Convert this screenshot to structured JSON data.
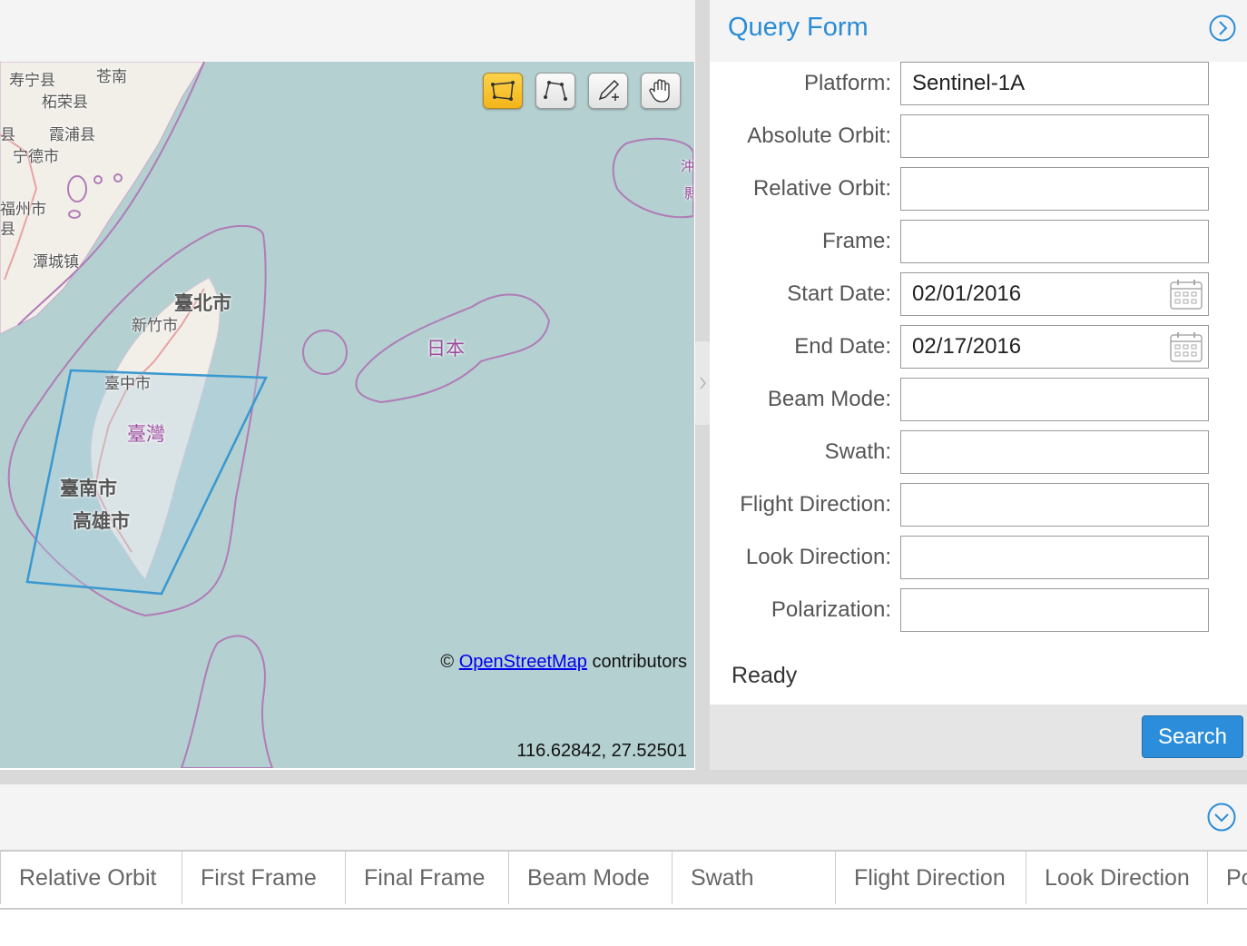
{
  "map": {
    "labels": {
      "shouning": "寿宁县",
      "cangnan": "苍南",
      "zherong": "柘荣县",
      "xiapu": "霞浦县",
      "county_left": "县",
      "ningde": "宁德市",
      "fuzhou": "福州市",
      "county_left2": "县",
      "tancheng": "潭城镇",
      "taipei": "臺北市",
      "hsinchu": "新竹市",
      "taichung": "臺中市",
      "taiwan": "臺灣",
      "tainan": "臺南市",
      "kaohsiung": "高雄市",
      "japan": "日本",
      "okinawa_partial": "沖",
      "okinawa_partial2": "縣"
    },
    "tools": [
      {
        "name": "box-draw",
        "active": true
      },
      {
        "name": "polygon-draw",
        "active": false
      },
      {
        "name": "point-edit",
        "active": false
      },
      {
        "name": "pan",
        "active": false
      }
    ],
    "attribution_prefix": "©",
    "attribution_link": "OpenStreetMap",
    "attribution_suffix": "contributors",
    "coordinates": "116.62842, 27.52501"
  },
  "form": {
    "title": "Query Form",
    "fields": [
      {
        "label": "Platform:",
        "value": "Sentinel-1A"
      },
      {
        "label": "Absolute Orbit:",
        "value": ""
      },
      {
        "label": "Relative Orbit:",
        "value": ""
      },
      {
        "label": "Frame:",
        "value": ""
      },
      {
        "label": "Start Date:",
        "value": "02/01/2016"
      },
      {
        "label": "End Date:",
        "value": "02/17/2016"
      },
      {
        "label": "Beam Mode:",
        "value": ""
      },
      {
        "label": "Swath:",
        "value": ""
      },
      {
        "label": "Flight Direction:",
        "value": ""
      },
      {
        "label": "Look Direction:",
        "value": ""
      },
      {
        "label": "Polarization:",
        "value": ""
      }
    ],
    "status": "Ready",
    "search_label": "Search"
  },
  "results": {
    "columns": [
      "Relative Orbit",
      "First Frame",
      "Final Frame",
      "Beam Mode",
      "Swath",
      "Flight Direction",
      "Look Direction",
      "Po"
    ]
  },
  "colors": {
    "accent": "#2b8cd6",
    "search_button": "#2c8edb",
    "active_tool": "#f2b51a",
    "map_water": "#b4d0d1",
    "aoi_outline": "#3a98d0"
  }
}
